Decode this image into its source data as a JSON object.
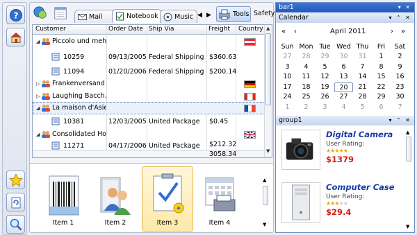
{
  "window": {
    "title": ""
  },
  "left_toolbar": {
    "items": [
      "help-icon",
      "house-icon"
    ]
  },
  "tabs": [
    {
      "label": "Mail",
      "icon": "mail-icon"
    },
    {
      "label": "Notebook",
      "icon": "notebook-icon"
    },
    {
      "label": "Music",
      "icon": "music-icon"
    }
  ],
  "toolbar": {
    "tools_label": "Tools",
    "safety_label": "Safety"
  },
  "grid": {
    "columns": [
      "Customer",
      "Order Date",
      "Ship Via",
      "Freight",
      "Country"
    ],
    "rows": [
      {
        "customer": "Piccolo und mehr",
        "date": "",
        "ship": "",
        "freight": "",
        "country": "Austria",
        "type": "group"
      },
      {
        "customer": "10259",
        "date": "09/13/2005",
        "ship": "Federal Shipping",
        "freight": "$360.63",
        "country": "",
        "type": "order"
      },
      {
        "customer": "11094",
        "date": "01/20/2006",
        "ship": "Federal Shipping",
        "freight": "$200.14",
        "country": "",
        "type": "order"
      },
      {
        "customer": "Frankenversand",
        "date": "",
        "ship": "",
        "freight": "",
        "country": "Germany",
        "type": "group-collapsed"
      },
      {
        "customer": "Laughing Bacch...",
        "date": "",
        "ship": "",
        "freight": "",
        "country": "Canada",
        "type": "group-collapsed"
      },
      {
        "customer": "La maison d'Asie",
        "date": "",
        "ship": "",
        "freight": "",
        "country": "France",
        "type": "group",
        "selected": true
      },
      {
        "customer": "10381",
        "date": "12/03/2005",
        "ship": "United Package",
        "freight": "$0.45",
        "country": "",
        "type": "order"
      },
      {
        "customer": "Consolidated Ho...",
        "date": "",
        "ship": "",
        "freight": "",
        "country": "United Kingdom",
        "type": "group"
      },
      {
        "customer": "11271",
        "date": "04/17/2006",
        "ship": "United Package",
        "freight": "$212.32",
        "country": "",
        "type": "order"
      }
    ],
    "total": "3058.34"
  },
  "gallery": {
    "items": [
      {
        "label": "Item 1",
        "icon": "barcode-icon"
      },
      {
        "label": "Item 2",
        "icon": "users-icon"
      },
      {
        "label": "Item 3",
        "icon": "checklist-icon",
        "selected": true
      },
      {
        "label": "Item 4",
        "icon": "calendar-fax-icon"
      }
    ]
  },
  "side_left": {
    "items": [
      "star-icon",
      "refresh-doc-icon",
      "magnifier-icon"
    ]
  },
  "dock": {
    "bar_title": "bar1",
    "calendar_title": "Calendar",
    "month": "April 2011",
    "weekdays": [
      "Sun",
      "Mon",
      "Tue",
      "Wed",
      "Thu",
      "Fri",
      "Sat"
    ],
    "weeks": [
      [
        "27",
        "28",
        "29",
        "30",
        "31",
        "1",
        "2"
      ],
      [
        "3",
        "4",
        "5",
        "6",
        "7",
        "8",
        "9"
      ],
      [
        "10",
        "11",
        "12",
        "13",
        "14",
        "15",
        "16"
      ],
      [
        "17",
        "18",
        "19",
        "20",
        "21",
        "22",
        "23"
      ],
      [
        "24",
        "25",
        "26",
        "27",
        "28",
        "29",
        "30"
      ],
      [
        "1",
        "2",
        "3",
        "4",
        "5",
        "6",
        "7"
      ]
    ],
    "today": "20",
    "group_title": "group1",
    "products": [
      {
        "name": "Digital Camera",
        "rating_label": "User Rating:",
        "stars": 5,
        "price": "$1379",
        "icon": "camera-icon"
      },
      {
        "name": "Computer Case",
        "rating_label": "User Rating:",
        "stars": 3,
        "price": "$29.4",
        "icon": "computer-case-icon"
      }
    ]
  },
  "colors": {
    "accent": "#2355b5",
    "price": "#d41b0e",
    "product_name": "#1a3aa6",
    "selection": "#fde9a8"
  }
}
